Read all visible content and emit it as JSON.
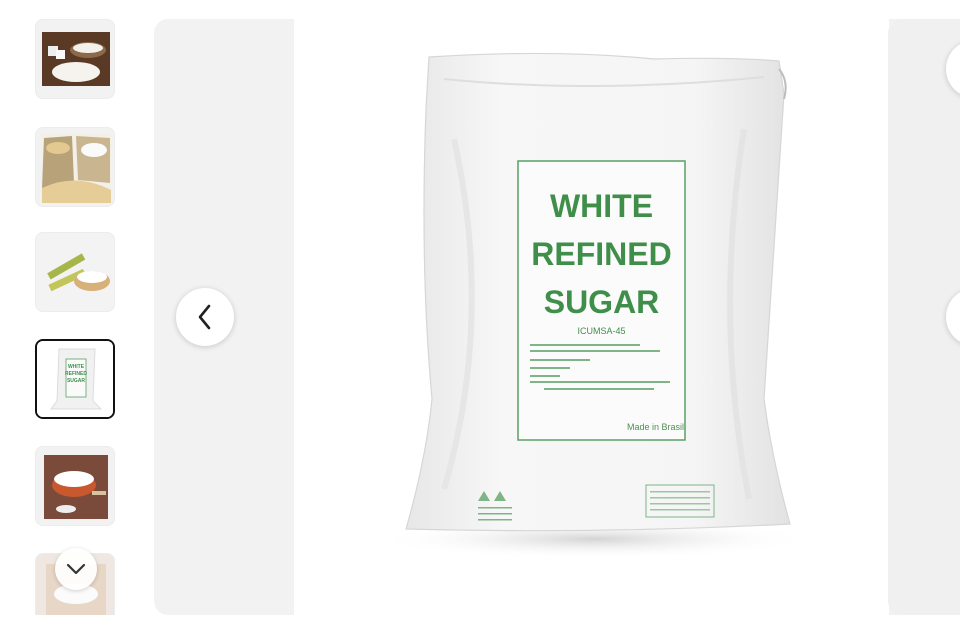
{
  "gallery": {
    "thumbnails": [
      {
        "name": "thumb-sugar-bowls",
        "selected": false
      },
      {
        "name": "thumb-sugar-sacks",
        "selected": false
      },
      {
        "name": "thumb-sugarcane-bowl",
        "selected": false
      },
      {
        "name": "thumb-white-refined-sugar-bag",
        "selected": true
      },
      {
        "name": "thumb-sugar-bowl-table",
        "selected": false
      },
      {
        "name": "thumb-sugar-partial",
        "selected": false
      }
    ],
    "thumb_scroll_icon": "chevron-down-icon",
    "prev_icon": "chevron-left-icon",
    "next_icon": "chevron-right-icon"
  },
  "product_image": {
    "title_line1": "WHITE",
    "title_line2": "REFINED",
    "title_line3": "SUGAR",
    "grade": "ICUMSA-45",
    "origin": "Made in Brasil"
  },
  "thumb_label": {
    "line1": "WHITE",
    "line2": "REFINED",
    "line3": "SUGAR"
  },
  "colors": {
    "label_green": "#3f8f4a",
    "viewer_bg": "#f2f2f2",
    "selected_border": "#111111"
  }
}
